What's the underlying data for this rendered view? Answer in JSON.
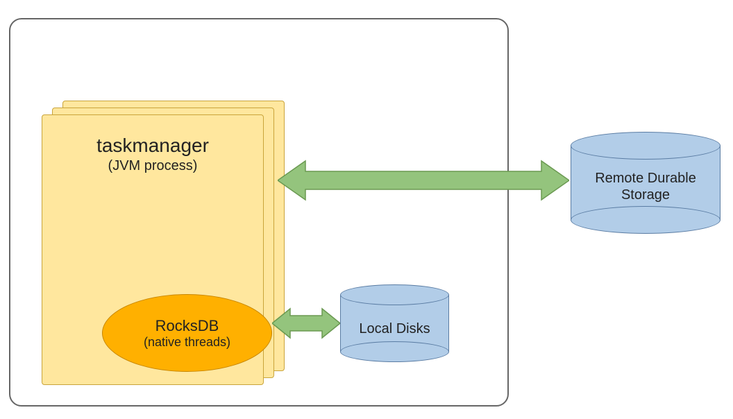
{
  "taskmanager": {
    "title": "taskmanager",
    "subtitle": "(JVM process)"
  },
  "rocksdb": {
    "title": "RocksDB",
    "subtitle": "(native threads)"
  },
  "local_disks": {
    "label": "Local Disks"
  },
  "remote_storage": {
    "label_line1": "Remote Durable",
    "label_line2": "Storage"
  },
  "colors": {
    "card_fill": "#ffe79e",
    "card_border": "#c9a43a",
    "ellipse_fill": "#ffb000",
    "ellipse_border": "#c78600",
    "cylinder_fill": "#b2cde8",
    "cylinder_border": "#5a7ca3",
    "arrow_fill": "#94c47d",
    "arrow_border": "#6b9a52"
  }
}
